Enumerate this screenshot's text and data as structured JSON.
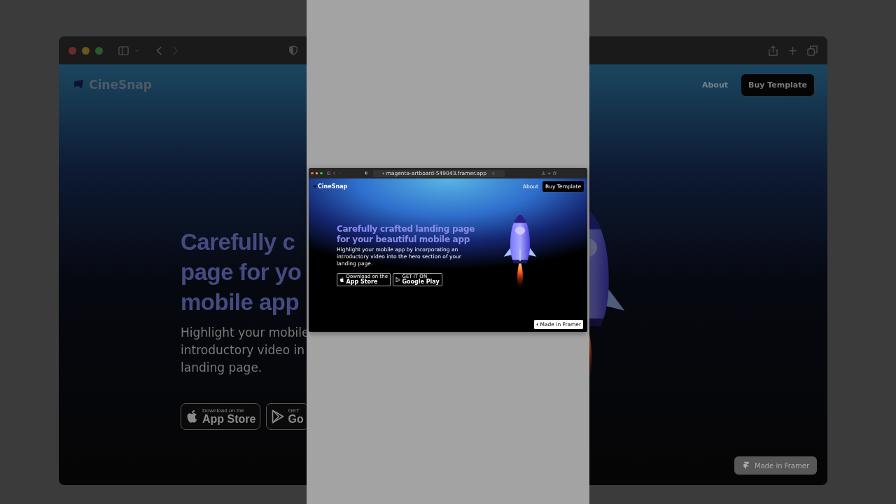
{
  "backdrop": {
    "logo": "CineSnap",
    "nav": [
      {
        "label": "About"
      }
    ],
    "cta": "Buy Template",
    "headline_lines": [
      "Carefully c",
      "page for yo",
      "mobile app"
    ],
    "body_lines": [
      "Highlight your mobile",
      "introductory video in",
      "landing page."
    ],
    "store_buttons": [
      {
        "kind": "apple",
        "small": "Download on the",
        "large": "App Store"
      },
      {
        "kind": "google",
        "small": "GET",
        "large": "Go"
      }
    ],
    "badge": "Made in Framer"
  },
  "browser": {
    "url": "magenta-artboard-549043.framer.app",
    "page": {
      "logo": "CineSnap",
      "nav": [
        {
          "label": "About"
        }
      ],
      "cta": "Buy Template",
      "headline": "Carefully crafted landing page for your beautiful mobile app",
      "body": "Highlight your mobile app by incorporating an introductory video into the hero section of your landing page.",
      "store_buttons": [
        {
          "kind": "apple",
          "small": "Download on the",
          "large": "App Store"
        },
        {
          "kind": "google",
          "small": "GET IT ON",
          "large": "Google Play"
        }
      ],
      "badge": "Made in Framer"
    }
  }
}
